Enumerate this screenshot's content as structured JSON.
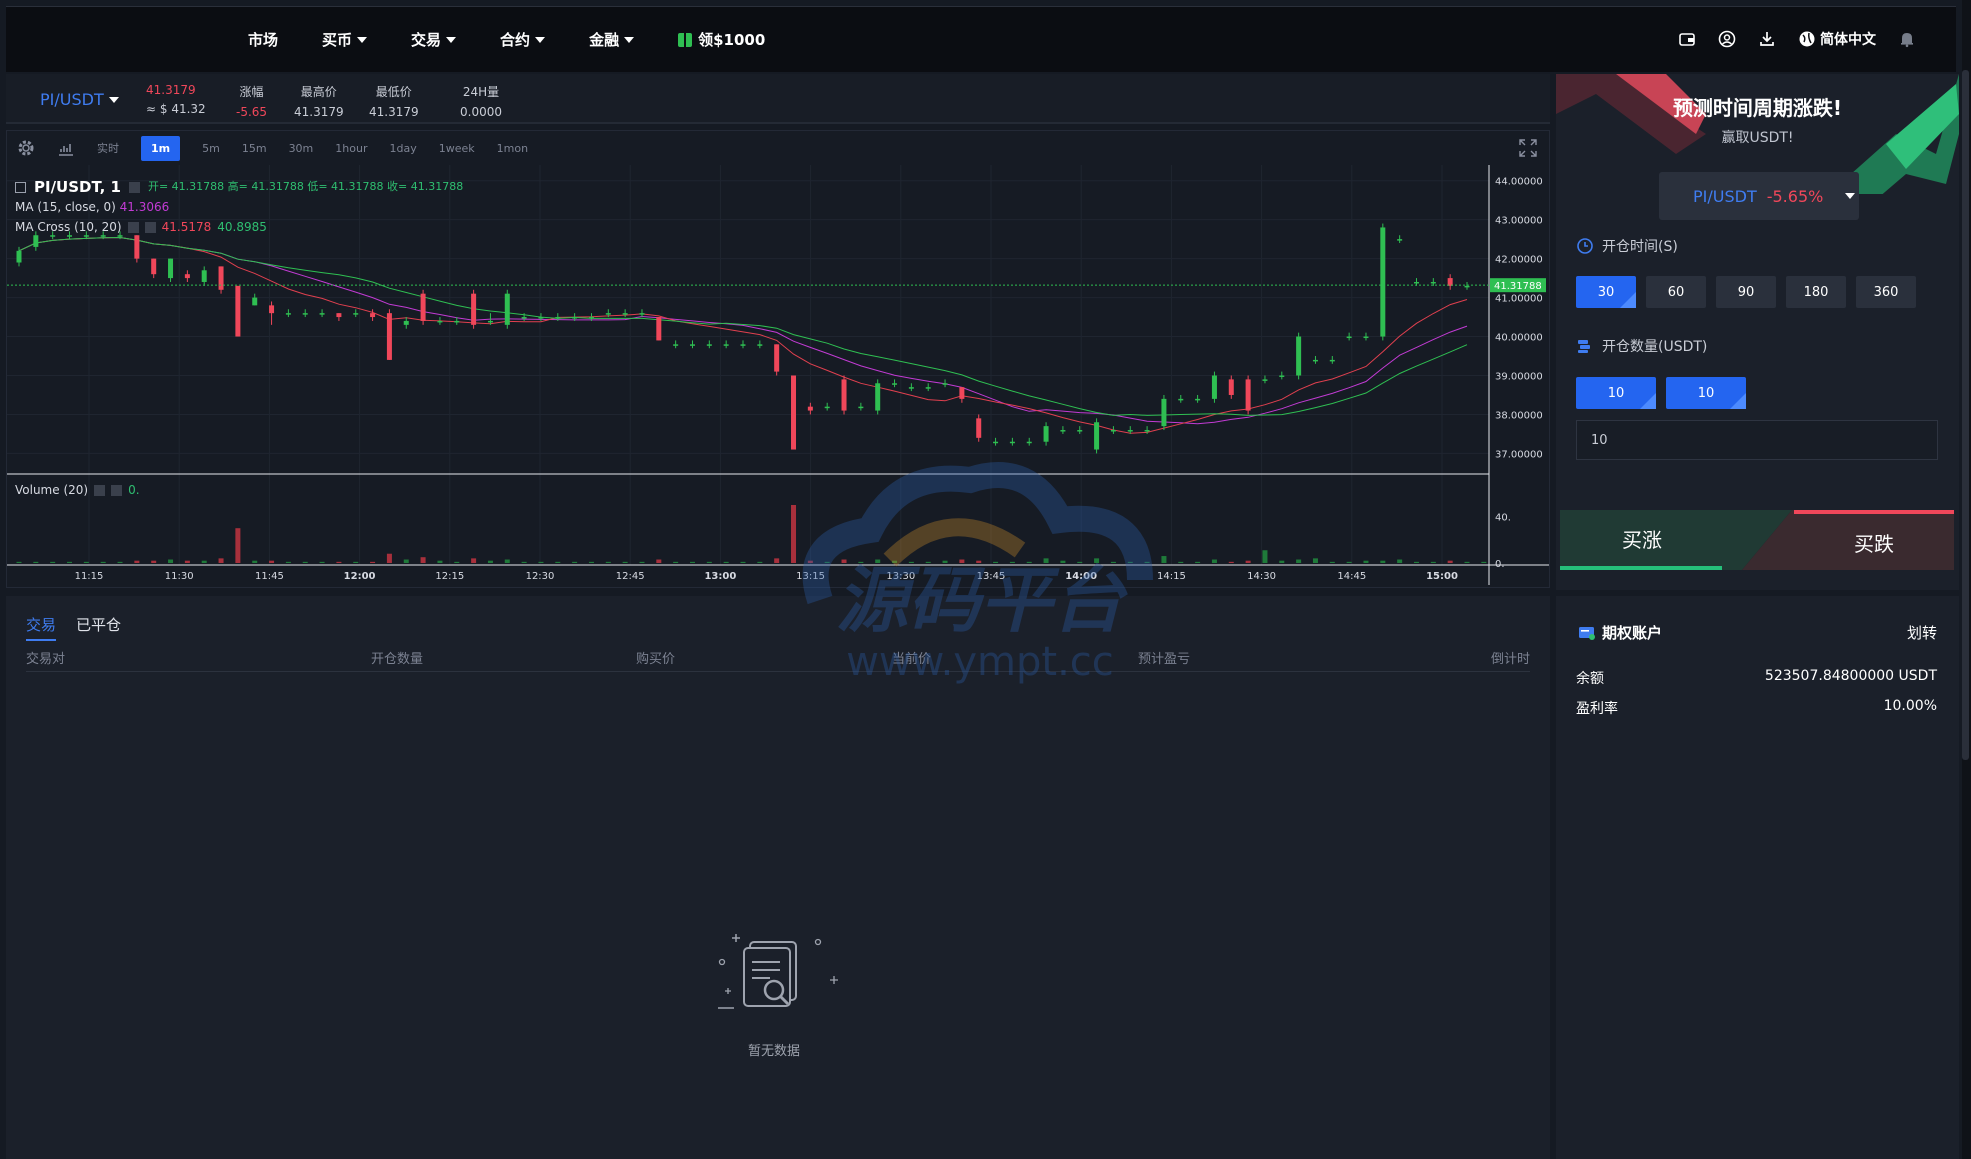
{
  "nav": {
    "items": [
      {
        "label": "市场",
        "dropdown": false
      },
      {
        "label": "买币",
        "dropdown": true
      },
      {
        "label": "交易",
        "dropdown": true
      },
      {
        "label": "合约",
        "dropdown": true
      },
      {
        "label": "金融",
        "dropdown": true
      }
    ],
    "promo": "领$1000",
    "language": "简体中文",
    "icons": [
      "wallet-icon",
      "user-icon",
      "download-icon",
      "globe-icon",
      "bell-icon"
    ]
  },
  "ticker": {
    "pair": "PI/USDT",
    "price": "41.3179",
    "price_usd": "≈ $ 41.32",
    "change_label": "涨幅",
    "change_value": "-5.65",
    "high_label": "最高价",
    "high_value": "41.3179",
    "low_label": "最低价",
    "low_value": "41.3179",
    "vol_label": "24H量",
    "vol_value": "0.0000"
  },
  "chart_toolbar": {
    "intervals": [
      "实时",
      "1m",
      "5m",
      "15m",
      "30m",
      "1hour",
      "1day",
      "1week",
      "1mon"
    ],
    "active": "1m"
  },
  "chart_legend": {
    "symbol": "PI/USDT, 1",
    "ohlc": "开= 41.31788 高= 41.31788 低= 41.31788 收= 41.31788",
    "ma_label": "MA (15, close, 0)",
    "ma_value": "41.3066",
    "cross_label": "MA Cross (10, 20)",
    "cross_v1": "41.5178",
    "cross_v2": "40.8985",
    "volume_label": "Volume (20)",
    "volume_value": "0."
  },
  "chart_data": {
    "type": "candlestick",
    "x_ticks": [
      "11:15",
      "11:30",
      "11:45",
      "12:00",
      "12:15",
      "12:30",
      "12:45",
      "13:00",
      "13:15",
      "13:30",
      "13:45",
      "14:00",
      "14:15",
      "14:30",
      "14:45",
      "15:00"
    ],
    "y_ticks": [
      "44.00000",
      "43.00000",
      "42.00000",
      "41.00000",
      "40.00000",
      "39.00000",
      "38.00000",
      "37.00000"
    ],
    "ylim": [
      36.6,
      44.3
    ],
    "last_price": "41.31788",
    "volume_ticks": [
      "40.",
      "0."
    ],
    "candles": [
      {
        "o": 41.9,
        "c": 42.2,
        "h": 42.3,
        "l": 41.8
      },
      {
        "o": 42.3,
        "c": 42.6,
        "h": 42.7,
        "l": 42.2
      },
      {
        "o": 42.6,
        "c": 42.6,
        "h": 42.7,
        "l": 42.5
      },
      {
        "o": 42.6,
        "c": 42.6,
        "h": 42.7,
        "l": 42.5
      },
      {
        "o": 42.6,
        "c": 42.6,
        "h": 42.7,
        "l": 42.5
      },
      {
        "o": 42.6,
        "c": 42.6,
        "h": 42.7,
        "l": 42.5
      },
      {
        "o": 42.6,
        "c": 42.6,
        "h": 42.7,
        "l": 42.5
      },
      {
        "o": 42.6,
        "c": 42.0,
        "h": 42.6,
        "l": 41.9
      },
      {
        "o": 42.0,
        "c": 41.6,
        "h": 42.0,
        "l": 41.5
      },
      {
        "o": 41.5,
        "c": 42.0,
        "h": 42.0,
        "l": 41.4
      },
      {
        "o": 41.6,
        "c": 41.5,
        "h": 41.7,
        "l": 41.4
      },
      {
        "o": 41.4,
        "c": 41.7,
        "h": 41.8,
        "l": 41.3
      },
      {
        "o": 41.8,
        "c": 41.2,
        "h": 41.8,
        "l": 41.1
      },
      {
        "o": 41.3,
        "c": 40.0,
        "h": 41.3,
        "l": 40.0
      },
      {
        "o": 40.8,
        "c": 41.0,
        "h": 41.1,
        "l": 40.8
      },
      {
        "o": 40.8,
        "c": 40.6,
        "h": 40.9,
        "l": 40.3
      },
      {
        "o": 40.6,
        "c": 40.6,
        "h": 40.7,
        "l": 40.5
      },
      {
        "o": 40.6,
        "c": 40.6,
        "h": 40.7,
        "l": 40.5
      },
      {
        "o": 40.6,
        "c": 40.6,
        "h": 40.7,
        "l": 40.5
      },
      {
        "o": 40.6,
        "c": 40.5,
        "h": 40.6,
        "l": 40.4
      },
      {
        "o": 40.6,
        "c": 40.6,
        "h": 40.7,
        "l": 40.5
      },
      {
        "o": 40.6,
        "c": 40.5,
        "h": 40.7,
        "l": 40.4
      },
      {
        "o": 40.6,
        "c": 39.4,
        "h": 40.7,
        "l": 39.4
      },
      {
        "o": 40.3,
        "c": 40.4,
        "h": 40.5,
        "l": 40.2
      },
      {
        "o": 41.1,
        "c": 40.4,
        "h": 41.2,
        "l": 40.3
      },
      {
        "o": 40.4,
        "c": 40.4,
        "h": 40.5,
        "l": 40.3
      },
      {
        "o": 40.4,
        "c": 40.4,
        "h": 40.5,
        "l": 40.3
      },
      {
        "o": 41.1,
        "c": 40.3,
        "h": 41.2,
        "l": 40.2
      },
      {
        "o": 40.4,
        "c": 40.4,
        "h": 40.6,
        "l": 40.3
      },
      {
        "o": 40.3,
        "c": 41.1,
        "h": 41.2,
        "l": 40.2
      },
      {
        "o": 40.5,
        "c": 40.5,
        "h": 40.6,
        "l": 40.4
      },
      {
        "o": 40.5,
        "c": 40.5,
        "h": 40.6,
        "l": 40.4
      },
      {
        "o": 40.5,
        "c": 40.5,
        "h": 40.6,
        "l": 40.4
      },
      {
        "o": 40.5,
        "c": 40.5,
        "h": 40.6,
        "l": 40.4
      },
      {
        "o": 40.5,
        "c": 40.5,
        "h": 40.6,
        "l": 40.4
      },
      {
        "o": 40.6,
        "c": 40.6,
        "h": 40.7,
        "l": 40.5
      },
      {
        "o": 40.6,
        "c": 40.6,
        "h": 40.7,
        "l": 40.5
      },
      {
        "o": 40.6,
        "c": 40.6,
        "h": 40.7,
        "l": 40.5
      },
      {
        "o": 40.5,
        "c": 39.9,
        "h": 40.5,
        "l": 39.9
      },
      {
        "o": 39.8,
        "c": 39.8,
        "h": 39.9,
        "l": 39.7
      },
      {
        "o": 39.8,
        "c": 39.8,
        "h": 39.9,
        "l": 39.7
      },
      {
        "o": 39.8,
        "c": 39.8,
        "h": 39.9,
        "l": 39.7
      },
      {
        "o": 39.8,
        "c": 39.8,
        "h": 39.9,
        "l": 39.7
      },
      {
        "o": 39.8,
        "c": 39.8,
        "h": 39.9,
        "l": 39.7
      },
      {
        "o": 39.8,
        "c": 39.8,
        "h": 39.9,
        "l": 39.7
      },
      {
        "o": 39.8,
        "c": 39.1,
        "h": 39.8,
        "l": 39.0
      },
      {
        "o": 39.0,
        "c": 37.1,
        "h": 39.0,
        "l": 37.1
      },
      {
        "o": 38.2,
        "c": 38.1,
        "h": 38.3,
        "l": 38.0
      },
      {
        "o": 38.2,
        "c": 38.2,
        "h": 38.3,
        "l": 38.1
      },
      {
        "o": 38.9,
        "c": 38.1,
        "h": 39.0,
        "l": 38.0
      },
      {
        "o": 38.2,
        "c": 38.2,
        "h": 38.3,
        "l": 38.1
      },
      {
        "o": 38.1,
        "c": 38.8,
        "h": 38.9,
        "l": 38.0
      },
      {
        "o": 38.8,
        "c": 38.8,
        "h": 38.9,
        "l": 38.7
      },
      {
        "o": 38.7,
        "c": 38.7,
        "h": 38.8,
        "l": 38.6
      },
      {
        "o": 38.7,
        "c": 38.7,
        "h": 38.8,
        "l": 38.6
      },
      {
        "o": 38.8,
        "c": 38.8,
        "h": 38.9,
        "l": 38.7
      },
      {
        "o": 38.7,
        "c": 38.4,
        "h": 38.7,
        "l": 38.3
      },
      {
        "o": 37.9,
        "c": 37.4,
        "h": 38.0,
        "l": 37.3
      },
      {
        "o": 37.3,
        "c": 37.3,
        "h": 37.4,
        "l": 37.2
      },
      {
        "o": 37.3,
        "c": 37.3,
        "h": 37.4,
        "l": 37.2
      },
      {
        "o": 37.3,
        "c": 37.3,
        "h": 37.4,
        "l": 37.2
      },
      {
        "o": 37.3,
        "c": 37.7,
        "h": 37.8,
        "l": 37.2
      },
      {
        "o": 37.6,
        "c": 37.6,
        "h": 37.7,
        "l": 37.5
      },
      {
        "o": 37.6,
        "c": 37.6,
        "h": 37.7,
        "l": 37.5
      },
      {
        "o": 37.1,
        "c": 37.8,
        "h": 37.9,
        "l": 37.0
      },
      {
        "o": 37.6,
        "c": 37.6,
        "h": 37.7,
        "l": 37.5
      },
      {
        "o": 37.6,
        "c": 37.6,
        "h": 37.7,
        "l": 37.5
      },
      {
        "o": 37.6,
        "c": 37.6,
        "h": 37.7,
        "l": 37.5
      },
      {
        "o": 37.7,
        "c": 38.4,
        "h": 38.5,
        "l": 37.6
      },
      {
        "o": 38.4,
        "c": 38.4,
        "h": 38.5,
        "l": 38.3
      },
      {
        "o": 38.4,
        "c": 38.4,
        "h": 38.5,
        "l": 38.3
      },
      {
        "o": 38.4,
        "c": 39.0,
        "h": 39.1,
        "l": 38.3
      },
      {
        "o": 38.9,
        "c": 38.5,
        "h": 39.0,
        "l": 38.4
      },
      {
        "o": 38.9,
        "c": 38.1,
        "h": 39.0,
        "l": 38.0
      },
      {
        "o": 38.9,
        "c": 38.9,
        "h": 39.0,
        "l": 38.8
      },
      {
        "o": 39.0,
        "c": 39.0,
        "h": 39.1,
        "l": 38.9
      },
      {
        "o": 39.0,
        "c": 40.0,
        "h": 40.1,
        "l": 38.9
      },
      {
        "o": 39.4,
        "c": 39.4,
        "h": 39.5,
        "l": 39.3
      },
      {
        "o": 39.4,
        "c": 39.4,
        "h": 39.5,
        "l": 39.3
      },
      {
        "o": 40.0,
        "c": 40.0,
        "h": 40.1,
        "l": 39.9
      },
      {
        "o": 40.0,
        "c": 40.0,
        "h": 40.1,
        "l": 39.9
      },
      {
        "o": 40.0,
        "c": 42.8,
        "h": 42.9,
        "l": 39.9
      },
      {
        "o": 42.5,
        "c": 42.5,
        "h": 42.6,
        "l": 42.4
      },
      {
        "o": 41.4,
        "c": 41.4,
        "h": 41.5,
        "l": 41.3
      },
      {
        "o": 41.4,
        "c": 41.4,
        "h": 41.5,
        "l": 41.3
      },
      {
        "o": 41.5,
        "c": 41.3,
        "h": 41.6,
        "l": 41.2
      },
      {
        "o": 41.3,
        "c": 41.3,
        "h": 41.4,
        "l": 41.2
      }
    ],
    "volumes": [
      1,
      1,
      1,
      1,
      1,
      1,
      1,
      2,
      2,
      3,
      2,
      2,
      4,
      30,
      2,
      2,
      1,
      1,
      1,
      1,
      1,
      1,
      8,
      3,
      5,
      2,
      1,
      4,
      2,
      3,
      1,
      1,
      1,
      1,
      1,
      1,
      1,
      1,
      3,
      1,
      1,
      1,
      1,
      1,
      1,
      4,
      50,
      2,
      1,
      3,
      1,
      3,
      2,
      1,
      1,
      2,
      3,
      2,
      1,
      1,
      1,
      4,
      2,
      1,
      4,
      1,
      1,
      1,
      6,
      1,
      1,
      3,
      1,
      2,
      11,
      2,
      3,
      4,
      1,
      1,
      2,
      2,
      3,
      1,
      1,
      2,
      1,
      1
    ],
    "colors": {
      "up": "#2fbf52",
      "down": "#f0475a",
      "ma": "#c23bd4",
      "cross1": "#e0404f",
      "cross2": "#2fbf52"
    }
  },
  "side": {
    "banner_title": "预测时间周期涨跌!",
    "banner_sub": "赢取USDT!",
    "pair": "PI/USDT",
    "pair_change": "-5.65%",
    "open_time_label": "开仓时间(S)",
    "time_options": [
      "30",
      "60",
      "90",
      "180",
      "360"
    ],
    "time_selected": "30",
    "open_qty_label": "开仓数量(USDT)",
    "qty_options": [
      "10",
      "10"
    ],
    "qty_input": "10",
    "buy_up": "买涨",
    "buy_down": "买跌"
  },
  "orders": {
    "tab_trade": "交易",
    "tab_closed": "已平仓",
    "columns": [
      "交易对",
      "开仓数量",
      "购买价",
      "当前价",
      "预计盈亏",
      "倒计时"
    ],
    "empty": "暂无数据"
  },
  "account": {
    "title": "期权账户",
    "transfer": "划转",
    "balance_label": "余额",
    "balance_value": "523507.84800000 USDT",
    "profit_label": "盈利率",
    "profit_value": "10.00%"
  },
  "watermark": {
    "main": "源码平台",
    "url": "www.ympt.cc"
  }
}
